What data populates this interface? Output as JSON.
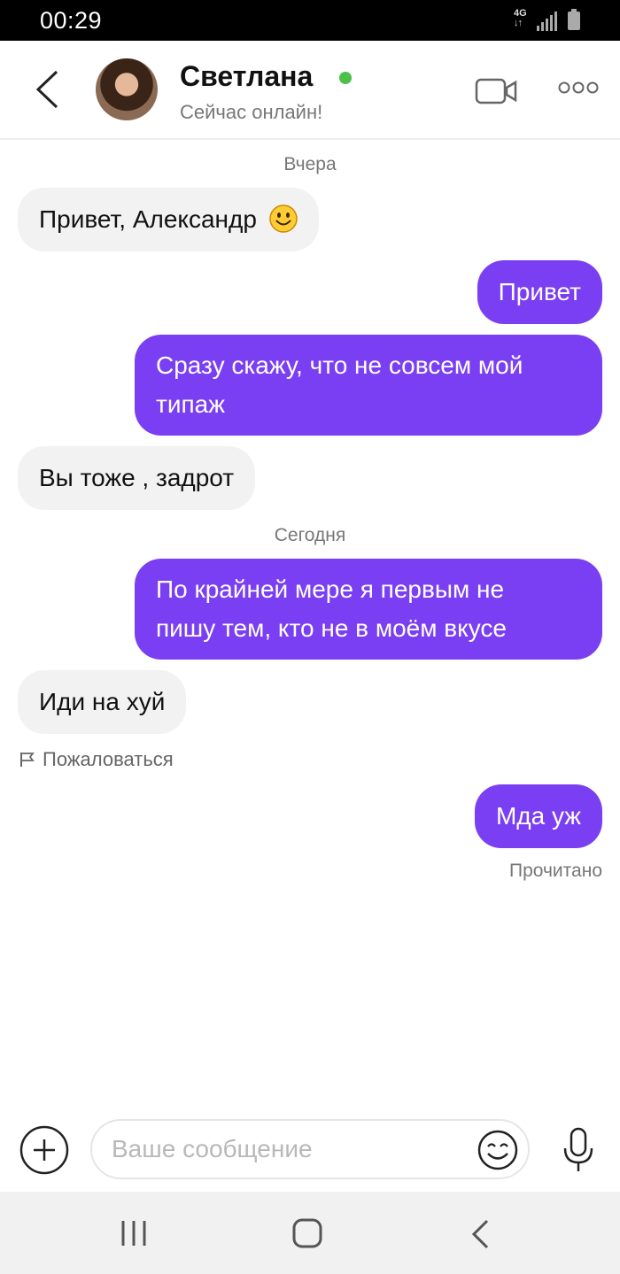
{
  "status_bar": {
    "time": "00:29",
    "network": "4G"
  },
  "header": {
    "contact_name": "Светлана",
    "contact_status": "Сейчас онлайн!"
  },
  "chat": {
    "date_yesterday": "Вчера",
    "date_today": "Сегодня",
    "messages": [
      {
        "direction": "in",
        "text": "Привет, Александр"
      },
      {
        "direction": "out",
        "text": "Привет"
      },
      {
        "direction": "out",
        "lines": [
          "Сразу скажу, что не совсем мой",
          "типаж"
        ]
      },
      {
        "direction": "in",
        "text": "Вы тоже , задрот"
      },
      {
        "direction": "out",
        "lines": [
          "По крайней мере я первым не",
          "пишу тем, кто не в моём вкусе"
        ]
      },
      {
        "direction": "in",
        "text": "Иди на хуй"
      },
      {
        "direction": "out",
        "text": "Мда уж"
      }
    ],
    "report_label": "Пожаловаться",
    "read_status": "Прочитано"
  },
  "composer": {
    "placeholder": "Ваше сообщение",
    "value": ""
  },
  "colors": {
    "accent": "#7a3ff2",
    "online": "#4cc04a",
    "incoming_bubble": "#f2f2f2"
  },
  "icons": [
    "back-chevron-icon",
    "video-call-icon",
    "more-icon",
    "smiley-emoji-icon",
    "flag-icon",
    "add-icon",
    "emoji-icon",
    "microphone-icon",
    "nav-recent-icon",
    "nav-home-icon",
    "nav-back-icon"
  ]
}
